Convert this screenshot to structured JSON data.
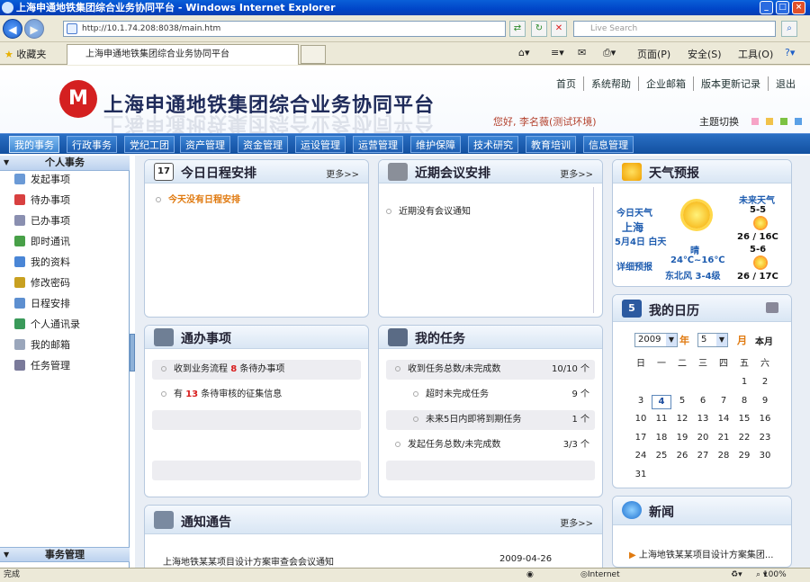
{
  "browser": {
    "title": "上海申通地铁集团综合业务协同平台 - Windows Internet Explorer",
    "url": "http://10.1.74.208:8038/main.htm",
    "search_placeholder": "Live Search",
    "favorites": "收藏夹",
    "tab_title": "上海申通地铁集团综合业务协同平台",
    "menu_page": "页面(P)",
    "menu_safety": "安全(S)",
    "menu_tools": "工具(O)"
  },
  "header": {
    "site_title": "上海申通地铁集团综合业务协同平台",
    "links": [
      "首页",
      "系统帮助",
      "企业邮箱",
      "版本更新记录",
      "退出"
    ],
    "greeting": "您好, 李名薇(测试环境)",
    "theme_label": "主题切换",
    "theme_colors": [
      "#f6a3c6",
      "#f1c24a",
      "#7cc242",
      "#5aa0e6"
    ]
  },
  "nav": [
    "我的事务",
    "行政事务",
    "党纪工团",
    "资产管理",
    "资金管理",
    "运设管理",
    "运营管理",
    "维护保障",
    "技术研究",
    "教育培训",
    "信息管理"
  ],
  "sidebar": {
    "section_title": "个人事务",
    "items": [
      "发起事项",
      "待办事项",
      "已办事项",
      "即时通讯",
      "我的资料",
      "修改密码",
      "日程安排",
      "个人通讯录",
      "我的邮箱",
      "任务管理"
    ],
    "bottom_title": "事务管理"
  },
  "schedule": {
    "title": "今日日程安排",
    "more": "更多>>",
    "icon_day": "17",
    "empty": "今天没有日程安排"
  },
  "meeting": {
    "title": "近期会议安排",
    "more": "更多>>",
    "empty": "近期没有会议通知"
  },
  "todo": {
    "title": "通办事项",
    "row1_a": "收到业务流程",
    "row1_n": "8",
    "row1_b": "条待办事项",
    "row2_a": "有",
    "row2_n": "13",
    "row2_b": "条待审核的征集信息"
  },
  "tasks": {
    "title": "我的任务",
    "rows": [
      {
        "label": "收到任务总数/未完成数",
        "value": "10/10 个"
      },
      {
        "label": "超时未完成任务",
        "value": "9 个"
      },
      {
        "label": "未来5日内即将到期任务",
        "value": "1 个"
      },
      {
        "label": "发起任务总数/未完成数",
        "value": "3/3 个"
      }
    ]
  },
  "notice": {
    "title": "通知通告",
    "more": "更多>>",
    "item": "上海地铁某某项目设计方案审查会会议通知",
    "date": "2009-04-26"
  },
  "weather": {
    "title": "天气预报",
    "today_label": "今日天气",
    "city": "上海",
    "date": "5月4日 白天",
    "detail": "详细预报",
    "condition": "晴",
    "temp": "24℃~16℃",
    "wind": "东北风 3-4级",
    "future_label": "未来天气",
    "d1": "5-5",
    "d1_temp": "26 / 16C",
    "d2": "5-6",
    "d2_temp": "26 / 17C"
  },
  "calendar": {
    "title": "我的日历",
    "icon_day": "5",
    "year": "2009",
    "year_unit": "年",
    "month": "5",
    "month_unit": "月",
    "this_month": "本月",
    "weekdays": [
      "日",
      "一",
      "二",
      "三",
      "四",
      "五",
      "六"
    ],
    "days": [
      "1",
      "2",
      "3",
      "4",
      "5",
      "6",
      "7",
      "8",
      "9",
      "10",
      "11",
      "12",
      "13",
      "14",
      "15",
      "16",
      "17",
      "18",
      "19",
      "20",
      "21",
      "22",
      "23",
      "24",
      "25",
      "26",
      "27",
      "28",
      "29",
      "30",
      "31"
    ],
    "today": "4"
  },
  "news": {
    "title": "新闻",
    "item": "上海地铁某某项目设计方案集团..."
  },
  "status": {
    "left": "完成",
    "zone": "Internet",
    "zoom": "100%"
  }
}
